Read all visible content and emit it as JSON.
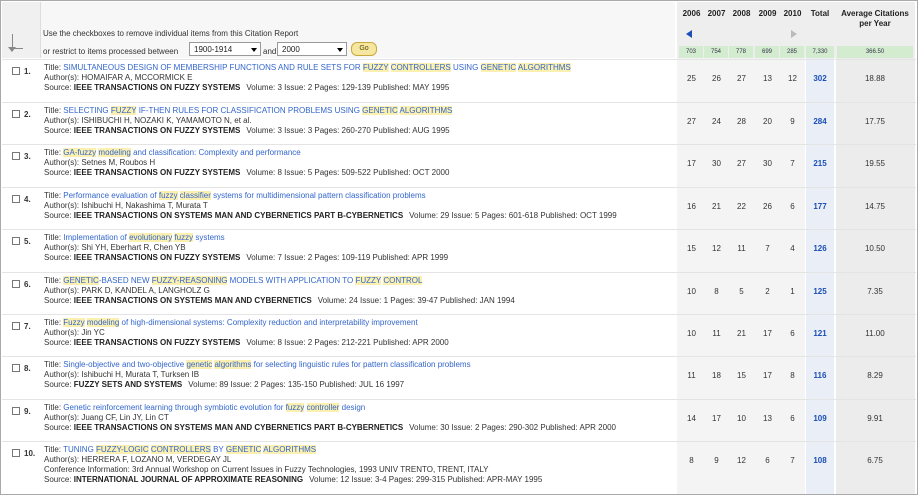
{
  "header": {
    "instruction_line1": "Use the checkboxes to remove individual items from this Citation Report",
    "instruction_line2": "or restrict to items processed between",
    "from_year": "1900-1914",
    "and_text": "and",
    "to_year": "2000",
    "go_label": "Go",
    "years": [
      "2006",
      "2007",
      "2008",
      "2009",
      "2010"
    ],
    "total_label": "Total",
    "avg_label_1": "Average Citations",
    "avg_label_2": "per Year",
    "year_totals": [
      "703",
      "754",
      "778",
      "699",
      "285"
    ],
    "grand_total": "7,330",
    "avg_total": "366.50"
  },
  "records": [
    {
      "num": "1.",
      "title": "Title: ",
      "title_link": "SIMULTANEOUS DESIGN OF MEMBERSHIP FUNCTIONS AND RULE SETS FOR FUZZY CONTROLLERS USING GENETIC ALGORITHMS",
      "authors": "Author(s): HOMAIFAR A, MCCORMICK E",
      "conf": "",
      "source_label": "Source: ",
      "source": "IEEE TRANSACTIONS ON FUZZY SYSTEMS",
      "details": "Volume: 3   Issue: 2   Pages: 129-139   Published: MAY 1995",
      "counts": [
        "25",
        "26",
        "27",
        "13",
        "12"
      ],
      "total": "302",
      "avg": "18.88"
    },
    {
      "num": "2.",
      "title": "Title: ",
      "title_link": "SELECTING FUZZY IF-THEN RULES FOR CLASSIFICATION PROBLEMS USING GENETIC ALGORITHMS",
      "authors": "Author(s): ISHIBUCHI H, NOZAKI K, YAMAMOTO N, et al.",
      "conf": "",
      "source_label": "Source: ",
      "source": "IEEE TRANSACTIONS ON FUZZY SYSTEMS",
      "details": "Volume: 3   Issue: 3   Pages: 260-270   Published: AUG 1995",
      "counts": [
        "27",
        "24",
        "28",
        "20",
        "9"
      ],
      "total": "284",
      "avg": "17.75"
    },
    {
      "num": "3.",
      "title": "Title: ",
      "title_link": "GA-fuzzy modeling and classification: Complexity and performance",
      "authors": "Author(s): Setnes M, Roubos H",
      "conf": "",
      "source_label": "Source: ",
      "source": "IEEE TRANSACTIONS ON FUZZY SYSTEMS",
      "details": "Volume: 8   Issue: 5   Pages: 509-522   Published: OCT 2000",
      "counts": [
        "17",
        "30",
        "27",
        "30",
        "7"
      ],
      "total": "215",
      "avg": "19.55"
    },
    {
      "num": "4.",
      "title": "Title: ",
      "title_link": "Performance evaluation of fuzzy classifier systems for multidimensional pattern classification problems",
      "authors": "Author(s): Ishibuchi H, Nakashima T, Murata T",
      "conf": "",
      "source_label": "Source: ",
      "source": "IEEE TRANSACTIONS ON SYSTEMS MAN AND CYBERNETICS PART B-CYBERNETICS",
      "details": "Volume: 29   Issue: 5   Pages: 601-618   Published: OCT 1999",
      "counts": [
        "16",
        "21",
        "22",
        "26",
        "6"
      ],
      "total": "177",
      "avg": "14.75"
    },
    {
      "num": "5.",
      "title": "Title: ",
      "title_link": "Implementation of evolutionary fuzzy systems",
      "authors": "Author(s): Shi YH, Eberhart R, Chen YB",
      "conf": "",
      "source_label": "Source: ",
      "source": "IEEE TRANSACTIONS ON FUZZY SYSTEMS",
      "details": "Volume: 7   Issue: 2   Pages: 109-119   Published: APR 1999",
      "counts": [
        "15",
        "12",
        "11",
        "7",
        "4"
      ],
      "total": "126",
      "avg": "10.50"
    },
    {
      "num": "6.",
      "title": "Title: ",
      "title_link": "GENETIC-BASED NEW FUZZY-REASONING MODELS WITH APPLICATION TO FUZZY CONTROL",
      "authors": "Author(s): PARK D, KANDEL A, LANGHOLZ G",
      "conf": "",
      "source_label": "Source: ",
      "source": "IEEE TRANSACTIONS ON SYSTEMS MAN AND CYBERNETICS",
      "details": "Volume: 24   Issue: 1   Pages: 39-47   Published: JAN 1994",
      "counts": [
        "10",
        "8",
        "5",
        "2",
        "1"
      ],
      "total": "125",
      "avg": "7.35"
    },
    {
      "num": "7.",
      "title": "Title: ",
      "title_link": "Fuzzy modeling of high-dimensional systems: Complexity reduction and interpretability improvement",
      "authors": "Author(s): Jin YC",
      "conf": "",
      "source_label": "Source: ",
      "source": "IEEE TRANSACTIONS ON FUZZY SYSTEMS",
      "details": "Volume: 8   Issue: 2   Pages: 212-221   Published: APR 2000",
      "counts": [
        "10",
        "11",
        "21",
        "17",
        "6"
      ],
      "total": "121",
      "avg": "11.00"
    },
    {
      "num": "8.",
      "title": "Title: ",
      "title_link": "Single-objective and two-objective genetic algorithms for selecting linguistic rules for pattern classification problems",
      "authors": "Author(s): Ishibuchi H, Murata T, Turksen IB",
      "conf": "",
      "source_label": "Source: ",
      "source": "FUZZY SETS AND SYSTEMS",
      "details": "Volume: 89   Issue: 2   Pages: 135-150   Published: JUL 16 1997",
      "counts": [
        "11",
        "18",
        "15",
        "17",
        "8"
      ],
      "total": "116",
      "avg": "8.29"
    },
    {
      "num": "9.",
      "title": "Title: ",
      "title_link": "Genetic reinforcement learning through symbiotic evolution for fuzzy controller design",
      "authors": "Author(s): Juang CF, Lin JY, Lin CT",
      "conf": "",
      "source_label": "Source: ",
      "source": "IEEE TRANSACTIONS ON SYSTEMS MAN AND CYBERNETICS PART B-CYBERNETICS",
      "details": "Volume: 30   Issue: 2   Pages: 290-302   Published: APR 2000",
      "counts": [
        "14",
        "17",
        "10",
        "13",
        "6"
      ],
      "total": "109",
      "avg": "9.91"
    },
    {
      "num": "10.",
      "title": "Title: ",
      "title_link": "TUNING FUZZY-LOGIC CONTROLLERS BY GENETIC ALGORITHMS",
      "authors": "Author(s): HERRERA F, LOZANO M, VERDEGAY JL",
      "conf": "Conference Information: 3rd Annual Workshop on Current Issues in Fuzzy Technologies, 1993 UNIV TRENTO, TRENT, ITALY",
      "source_label": "Source: ",
      "source": "INTERNATIONAL JOURNAL OF APPROXIMATE REASONING",
      "details": "Volume: 12   Issue: 3-4   Pages: 299-315   Published: APR-MAY 1995",
      "counts": [
        "8",
        "9",
        "12",
        "6",
        "7"
      ],
      "total": "108",
      "avg": "6.75"
    }
  ],
  "highlight_terms": [
    "FUZZY",
    "GENETIC",
    "ALGORITHMS",
    "fuzzy",
    "genetic",
    "algorithms",
    "GA-fuzzy",
    "Fuzzy",
    "modeling",
    "classifier",
    "evolutionary",
    "FUZZY-REASONING",
    "CONTROL",
    "CONTROLLERS",
    "controller",
    "FUZZY-LOGIC"
  ],
  "colors": {
    "link": "#3366cc",
    "highlight": "#fbf0b0",
    "totals_row": "#d3ecd0",
    "year_col_bg": "#f4f4f4",
    "total_col_bg": "#e9eef7",
    "avg_col_bg": "#ececec"
  }
}
